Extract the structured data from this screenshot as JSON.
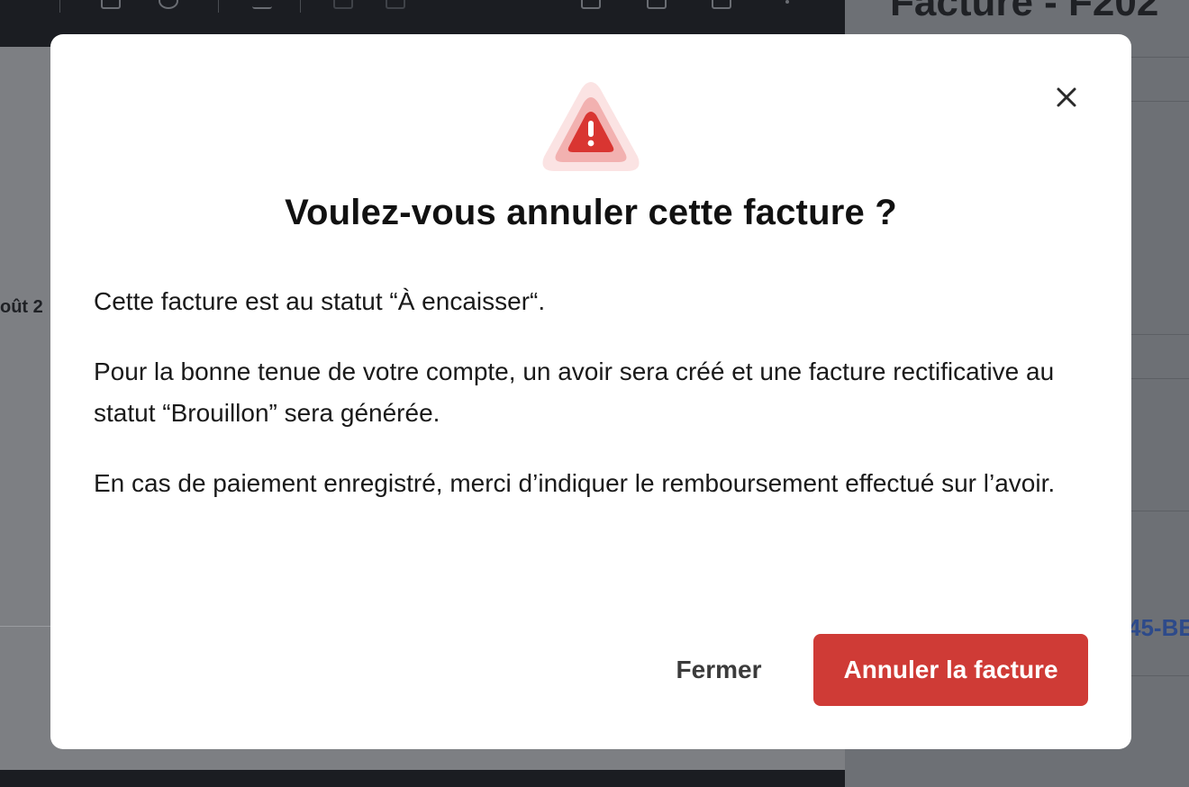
{
  "background": {
    "date_fragment": "oût 2",
    "panel_title": "Facture - F202",
    "reference_fragment": "45-BE"
  },
  "modal": {
    "title": "Voulez-vous annuler cette facture ?",
    "paragraphs": [
      "Cette facture est au statut “À encaisser“.",
      "Pour la bonne tenue de votre compte, un avoir sera créé et une facture rectificative au statut “Brouillon” sera générée.",
      "En cas de paiement enregistré, merci d’indiquer le remboursement effectué sur l’avoir."
    ],
    "close_label": "Fermer",
    "confirm_label": "Annuler la facture",
    "icons": {
      "warning": "warning-triangle-icon",
      "close": "close-x-icon"
    },
    "colors": {
      "danger": "#cf3b36",
      "warning_outer": "#fbe3e3",
      "warning_mid": "#f2b1b0",
      "warning_inner": "#d93531"
    }
  }
}
